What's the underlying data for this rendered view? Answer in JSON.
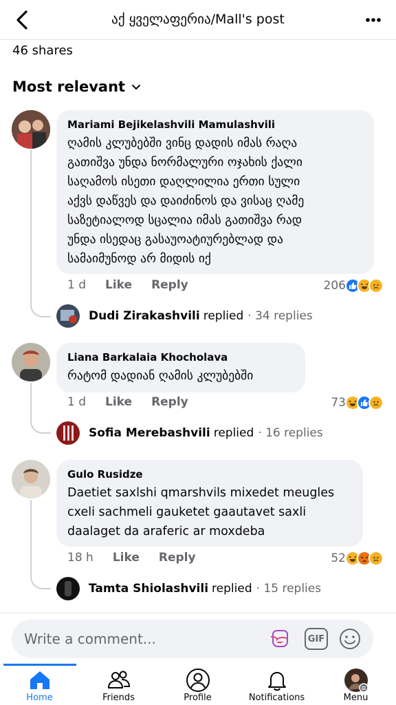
{
  "header": {
    "title": "აქ ყველაფერია/Mall's post"
  },
  "post": {
    "shares": "46 shares"
  },
  "sort": {
    "label": "Most relevant"
  },
  "comments": [
    {
      "author": "Mariami Bejikelashvili Mamulashvili",
      "lines": [
        "ღამის კლუბებში ვინც დადის იმას რაღა",
        "გათიშვა უნდა ნორმალური ოჯახის ქალი",
        "საღამოს ისეთი დაღლილია ერთი სული",
        "აქვს დაწვეს და დაიძინოს  და ვისაც ღამე",
        "საზეტიალოდ სცალია იმას გათიშვა რად",
        "უნდა ისედაც გასაუოატიურებლად და",
        "სამაიმუნოდ არ მიდის იქ"
      ],
      "time": "1 d",
      "like": "Like",
      "reply": "Reply",
      "reaction_count": "206",
      "reactions": [
        "like",
        "haha",
        "sad"
      ],
      "reply_preview": {
        "name": "Dudi Zirakashvili",
        "replied": "replied",
        "count": "· 34 replies"
      }
    },
    {
      "author": "Liana Barkalaia Khocholava",
      "lines": [
        "რატომ დადიან ღამის კლუბებში"
      ],
      "time": "1 d",
      "like": "Like",
      "reply": "Reply",
      "reaction_count": "73",
      "reactions": [
        "haha",
        "like",
        "sad"
      ],
      "reply_preview": {
        "name": "Sofia Merebashvili",
        "replied": "replied",
        "count": "· 16 replies"
      }
    },
    {
      "author": "Gulo Rusidze",
      "lines": [
        "Daetiet saxlshi qmarshvils mixedet meugles",
        "cxeli sachmeli gauketet gaautavet saxli",
        "daalaget  da araferic ar moxdeba"
      ],
      "time": "18 h",
      "like": "Like",
      "reply": "Reply",
      "reaction_count": "52",
      "reactions": [
        "haha",
        "angry",
        "sad"
      ],
      "reply_preview": {
        "name": "Tamta Shiolashvili",
        "replied": "replied",
        "count": "· 15 replies"
      }
    }
  ],
  "composer": {
    "placeholder": "Write a comment...",
    "gif_label": "GIF"
  },
  "tabs": [
    {
      "label": "Home",
      "icon": "home-icon",
      "active": true
    },
    {
      "label": "Friends",
      "icon": "friends-icon",
      "active": false
    },
    {
      "label": "Profile",
      "icon": "profile-icon",
      "active": false
    },
    {
      "label": "Notifications",
      "icon": "bell-icon",
      "active": false
    },
    {
      "label": "Menu",
      "icon": "menu-avatar-icon",
      "active": false
    }
  ],
  "colors": {
    "accent": "#1877f2",
    "bubble": "#f0f2f5",
    "secondary_text": "#65676b"
  }
}
